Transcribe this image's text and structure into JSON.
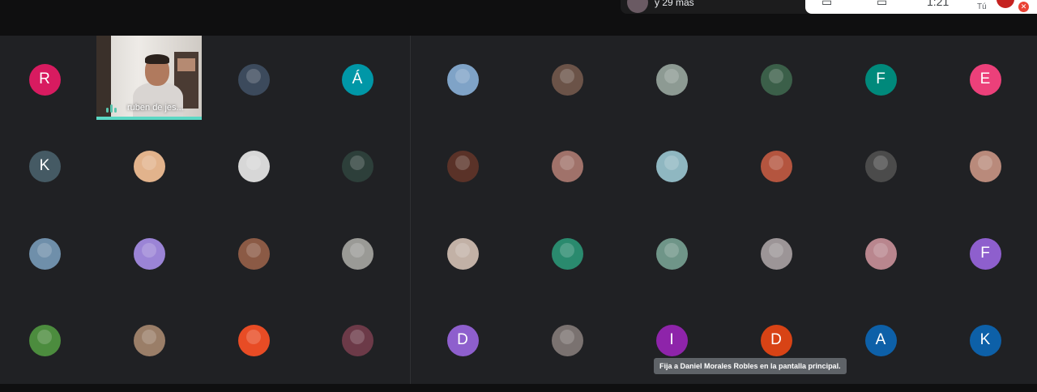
{
  "header": {
    "participants_more": "y 29 más",
    "clock": "1:21",
    "self_label": "Tú"
  },
  "speaker": {
    "name": "ruben de jes..."
  },
  "tooltip": "Fija a Daniel Morales Robles en la pantalla principal.",
  "tiles": [
    {
      "kind": "initial",
      "initial": "R",
      "color": "#d81b60"
    },
    {
      "kind": "photo",
      "color": "#3c4a5c"
    },
    {
      "kind": "initial",
      "initial": "Á",
      "color": "#0097a7"
    },
    {
      "kind": "photo",
      "color": "#7fa3c7"
    },
    {
      "kind": "photo",
      "color": "#6b5348"
    },
    {
      "kind": "photo",
      "color": "#8d9a93"
    },
    {
      "kind": "photo",
      "color": "#3b5f49"
    },
    {
      "kind": "initial",
      "initial": "F",
      "color": "#00897b"
    },
    {
      "kind": "initial",
      "initial": "E",
      "color": "#ec407a"
    },
    {
      "kind": "initial",
      "initial": "K",
      "color": "#455a64"
    },
    {
      "kind": "photo",
      "color": "#e2b38c"
    },
    {
      "kind": "photo",
      "color": "#d7d7d7"
    },
    {
      "kind": "photo",
      "color": "#2d3f3a"
    },
    {
      "kind": "photo",
      "color": "#5a3228"
    },
    {
      "kind": "photo",
      "color": "#a0726a"
    },
    {
      "kind": "photo",
      "color": "#8fb7c1"
    },
    {
      "kind": "photo",
      "color": "#b4553f"
    },
    {
      "kind": "photo",
      "color": "#4b4b4b"
    },
    {
      "kind": "photo",
      "color": "#b98a7b"
    },
    {
      "kind": "photo",
      "color": "#6f8faa"
    },
    {
      "kind": "photo",
      "color": "#9b84d6"
    },
    {
      "kind": "photo",
      "color": "#8b5a45"
    },
    {
      "kind": "photo",
      "color": "#9a9a96"
    },
    {
      "kind": "photo",
      "color": "#c2b1a6"
    },
    {
      "kind": "photo",
      "color": "#2a8a6e"
    },
    {
      "kind": "photo",
      "color": "#6f9588"
    },
    {
      "kind": "photo",
      "color": "#9c9597"
    },
    {
      "kind": "photo",
      "color": "#b9868e"
    },
    {
      "kind": "initial",
      "initial": "F",
      "color": "#8e5fcd"
    },
    {
      "kind": "photo",
      "color": "#4c8c3e"
    },
    {
      "kind": "photo",
      "color": "#9a7e68"
    },
    {
      "kind": "photo",
      "color": "#e84c25"
    },
    {
      "kind": "photo",
      "color": "#6c3a48"
    },
    {
      "kind": "initial",
      "initial": "D",
      "color": "#8e5fcd"
    },
    {
      "kind": "photo",
      "color": "#7a7270"
    },
    {
      "kind": "initial",
      "initial": "I",
      "color": "#8e24aa"
    },
    {
      "kind": "initial",
      "initial": "D",
      "color": "#d84315"
    },
    {
      "kind": "initial",
      "initial": "A",
      "color": "#0d60a8"
    },
    {
      "kind": "initial",
      "initial": "K",
      "color": "#0d60a8"
    }
  ]
}
